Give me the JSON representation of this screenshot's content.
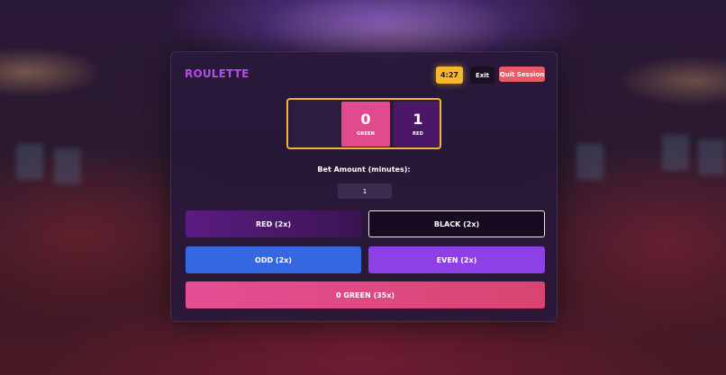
{
  "game": {
    "title": "ROULETTE",
    "timer": "4:27",
    "exit_label": "Exit",
    "quit_label": "Quit Session"
  },
  "wheel": {
    "slots": [
      {
        "number": "",
        "label": ""
      },
      {
        "number": "0",
        "label": "GREEN"
      },
      {
        "number": "1",
        "label": "RED"
      }
    ]
  },
  "bet": {
    "label": "Bet Amount (minutes):",
    "value": "1"
  },
  "buttons": {
    "red": "RED (2x)",
    "black": "BLACK (2x)",
    "odd": "ODD (2x)",
    "even": "EVEN (2x)",
    "green": "0 GREEN (35x)"
  },
  "colors": {
    "title": "#b24fe8",
    "timer": "#f5b730",
    "quit": "#e65b66",
    "wheel_border": "#efb637",
    "green_slot": "#e24a8e",
    "red_slot": "#4b1766",
    "odd": "#3568e0",
    "even": "#8f3fe6"
  }
}
